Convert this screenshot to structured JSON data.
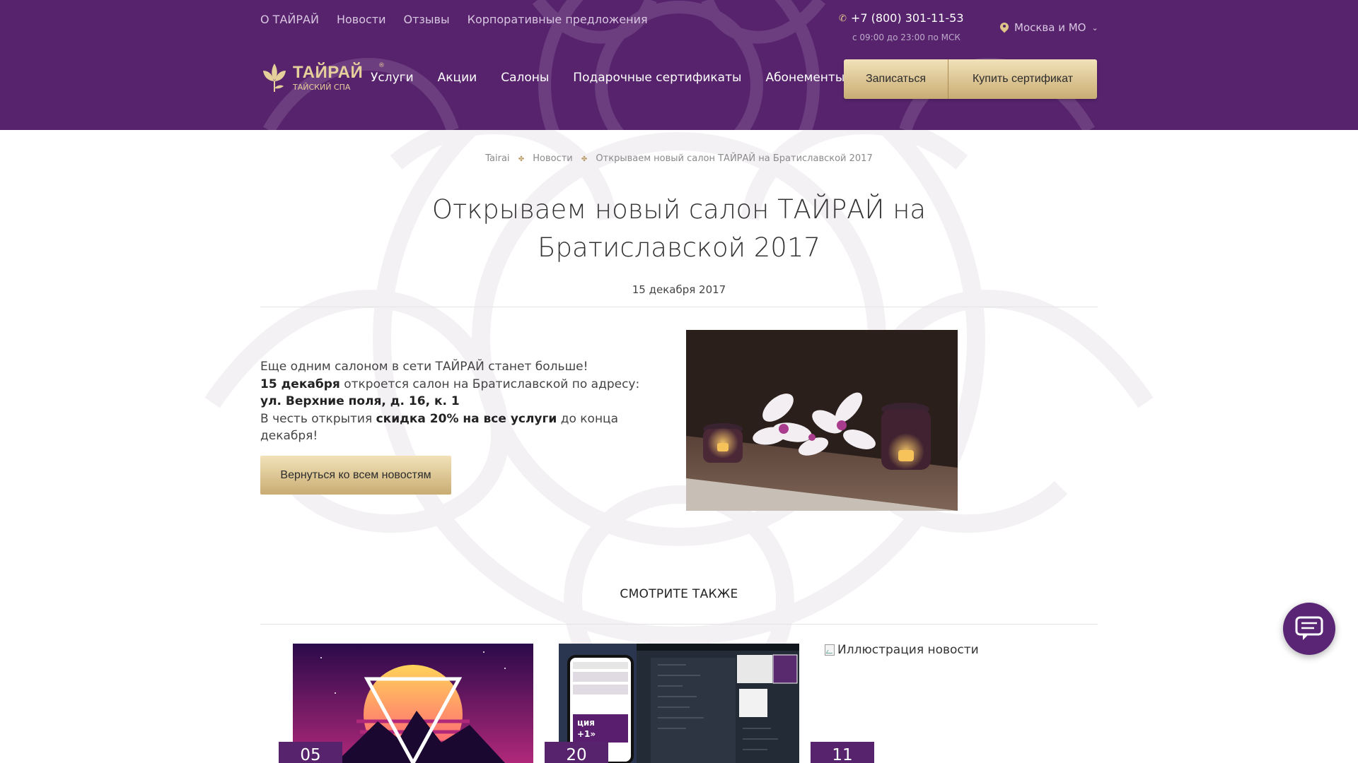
{
  "topnav": {
    "items": [
      "О ТАЙРАЙ",
      "Новости",
      "Отзывы",
      "Корпоративные предложения"
    ]
  },
  "contact": {
    "phone": "+7 (800) 301-11-53",
    "hours": "с 09:00 до 23:00 по МСК",
    "city": "Москва и МО"
  },
  "logo": {
    "name": "ТАЙРАЙ",
    "subtitle": "ТАЙСКИЙ СПА",
    "reg": "®"
  },
  "mainnav": {
    "items": [
      "Услуги",
      "Акции",
      "Салоны",
      "Подарочные сертификаты",
      "Абонементы"
    ]
  },
  "header_buttons": {
    "signup": "Записаться",
    "buy_cert": "Купить сертификат"
  },
  "breadcrumbs": [
    "Tairai",
    "Новости",
    "Открываем новый салон ТАЙРАЙ на Братиславской 2017"
  ],
  "article": {
    "title": "Открываем новый салон ТАЙРАЙ на Братиславской 2017",
    "date": "15 декабря 2017",
    "line1": "Еще одним салоном в сети ТАЙРАЙ станет больше!",
    "line2_bold": "15 декабря",
    "line2_text": " откроется салон на Братиславской по адресу: ",
    "line2_address": "ул. Верхние поля, д. 16, к. 1",
    "line3_text": "В честь открытия ",
    "line3_bold": "скидка 20% на все услуги",
    "line3_end": " до конца декабря!",
    "back_button": "Вернуться ко всем новостям"
  },
  "see_also": {
    "heading": "СМОТРИТЕ ТАКЖЕ",
    "cards": [
      {
        "day": "05"
      },
      {
        "day": "20"
      },
      {
        "day": "11",
        "alt": "Иллюстрация новости"
      }
    ],
    "card2_phone_text": "ция\n+1»"
  },
  "colors": {
    "brand_purple": "#57236d",
    "gold": "#e0c58a"
  }
}
